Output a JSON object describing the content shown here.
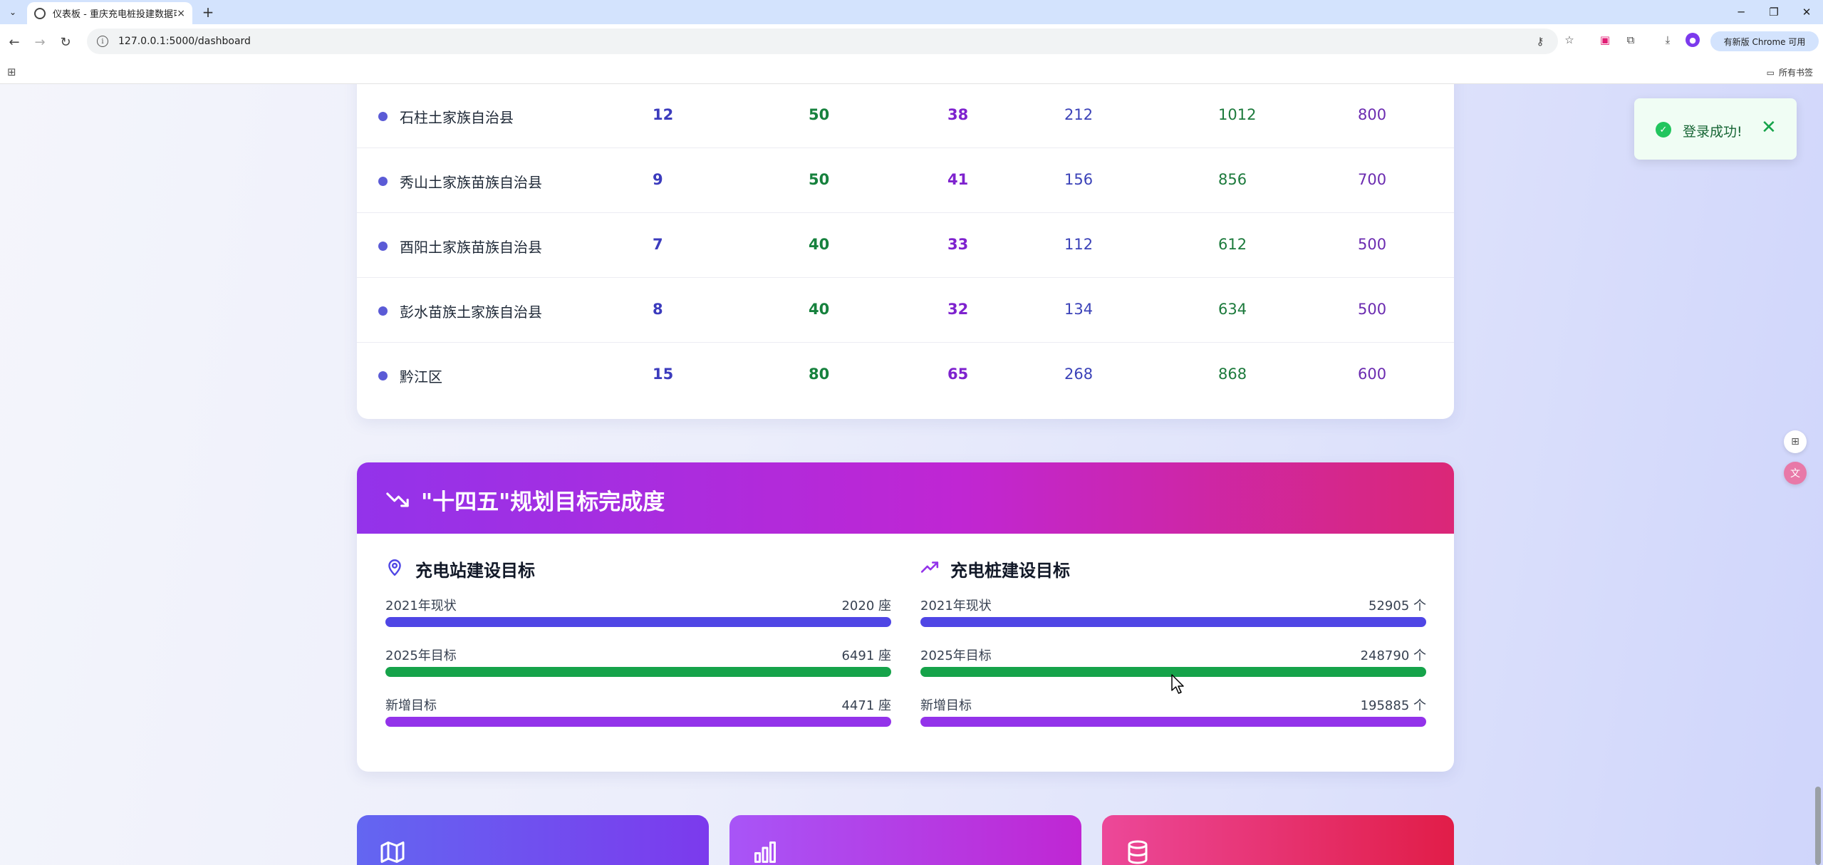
{
  "browser": {
    "tab_title": "仪表板 - 重庆充电桩投建数据可视化",
    "tab_close": "×",
    "new_tab": "+",
    "url": "127.0.0.1:5000/dashboard",
    "update_label": "有新版 Chrome 可用",
    "all_bookmarks": "所有书签",
    "win_minimize": "─",
    "win_restore": "❐",
    "win_close": "✕"
  },
  "table": {
    "rows": [
      {
        "name": "石柱土家族自治县",
        "c1": "12",
        "c2": "50",
        "c3": "38",
        "c4": "212",
        "c5": "1012",
        "c6": "800"
      },
      {
        "name": "秀山土家族苗族自治县",
        "c1": "9",
        "c2": "50",
        "c3": "41",
        "c4": "156",
        "c5": "856",
        "c6": "700"
      },
      {
        "name": "酉阳土家族苗族自治县",
        "c1": "7",
        "c2": "40",
        "c3": "33",
        "c4": "112",
        "c5": "612",
        "c6": "500"
      },
      {
        "name": "彭水苗族土家族自治县",
        "c1": "8",
        "c2": "40",
        "c3": "32",
        "c4": "134",
        "c5": "634",
        "c6": "500"
      },
      {
        "name": "黔江区",
        "c1": "15",
        "c2": "80",
        "c3": "65",
        "c4": "268",
        "c5": "868",
        "c6": "600"
      }
    ]
  },
  "goals": {
    "title": "\"十四五\"规划目标完成度",
    "stations": {
      "title": "充电站建设目标",
      "items": [
        {
          "label": "2021年现状",
          "value": "2020 座",
          "fill": 1.0,
          "color": "#4f46e5"
        },
        {
          "label": "2025年目标",
          "value": "6491 座",
          "fill": 1.0,
          "color": "#16a34a"
        },
        {
          "label": "新增目标",
          "value": "4471 座",
          "fill": 1.0,
          "color": "#9333ea"
        }
      ]
    },
    "piles": {
      "title": "充电桩建设目标",
      "items": [
        {
          "label": "2021年现状",
          "value": "52905 个",
          "fill": 1.0,
          "color": "#4f46e5"
        },
        {
          "label": "2025年目标",
          "value": "248790 个",
          "fill": 1.0,
          "color": "#16a34a"
        },
        {
          "label": "新增目标",
          "value": "195885 个",
          "fill": 1.0,
          "color": "#9333ea"
        }
      ]
    }
  },
  "toast": {
    "message": "登录成功!",
    "close": "✕",
    "check": "✓"
  },
  "colors": {
    "accent_blue": "#4f46e5",
    "accent_green": "#16a34a",
    "accent_purple": "#9333ea",
    "header_gradient_start": "#9333ea",
    "header_gradient_end": "#db2777"
  }
}
